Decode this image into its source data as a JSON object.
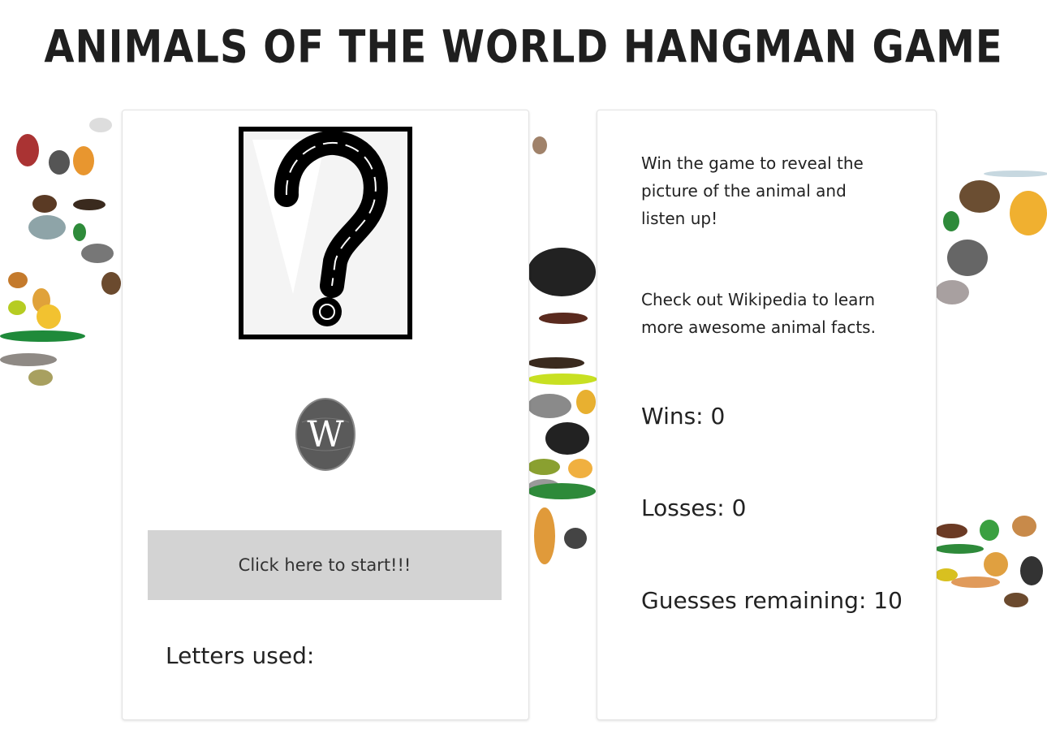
{
  "title": "Animals of the World Hangman Game",
  "left_card": {
    "mystery_image": "question-mark",
    "wiki_icon": "wikipedia-icon",
    "start_button": "Click here to start!!!",
    "letters_used_label": "Letters used:",
    "letters_used": ""
  },
  "right_card": {
    "info_1": "Win the game to reveal the picture of the animal and listen up!",
    "info_2": "Check out Wikipedia to learn more awesome animal facts.",
    "wins_label": "Wins:",
    "wins": "0",
    "losses_label": "Losses:",
    "losses": "0",
    "guesses_label": "Guesses remaining:",
    "guesses": "10"
  },
  "colors": {
    "button_bg": "#d3d3d3",
    "text": "#222222"
  }
}
